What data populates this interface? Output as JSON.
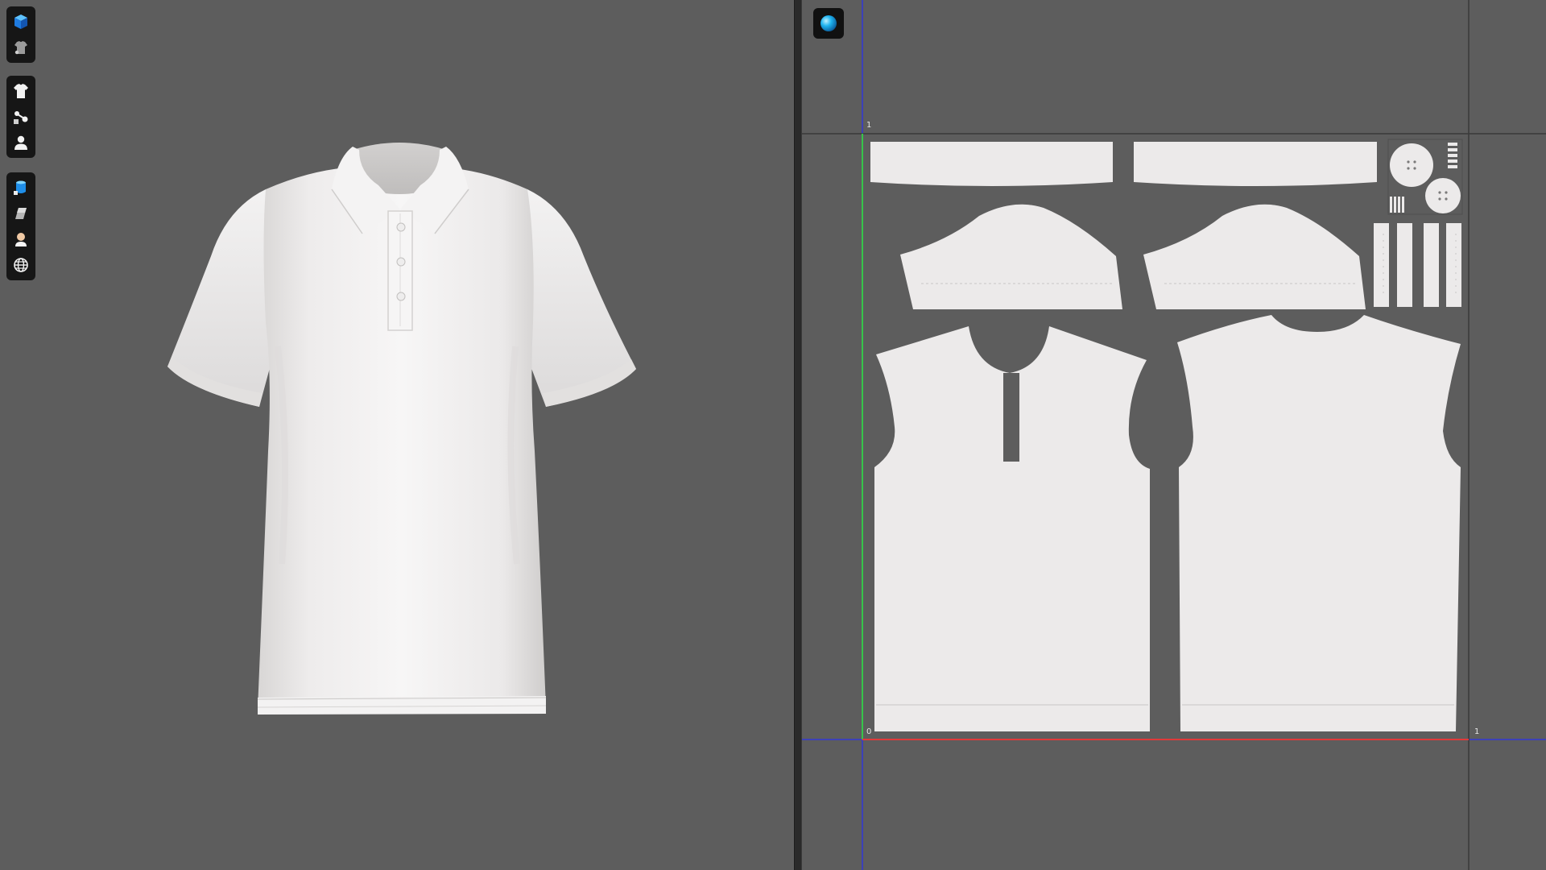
{
  "viewport_3d": {
    "toolbar_groups": [
      [
        "view-3d-cube-icon",
        "garment-avatar-icon"
      ],
      [
        "garment-shirt-icon",
        "fabric-nodes-icon",
        "avatar-person-icon"
      ],
      [
        "uv-cylinder-icon",
        "texture-sheet-icon",
        "avatar-bust-icon",
        "globe-icon"
      ]
    ]
  },
  "viewport_2d": {
    "render_mode_icon": "render-sphere-icon",
    "uv_labels": {
      "top_left": "1",
      "origin": "0",
      "right": "1"
    }
  },
  "colors": {
    "background": "#5d5d5d",
    "fabric": "#eceaea",
    "fabric_shadow": "#c9c7c6",
    "uv_u_axis": "#e03a3a",
    "uv_v_axis": "#37c44a",
    "guide_line": "#3238d6",
    "render_sphere": "#1eb4f0"
  }
}
